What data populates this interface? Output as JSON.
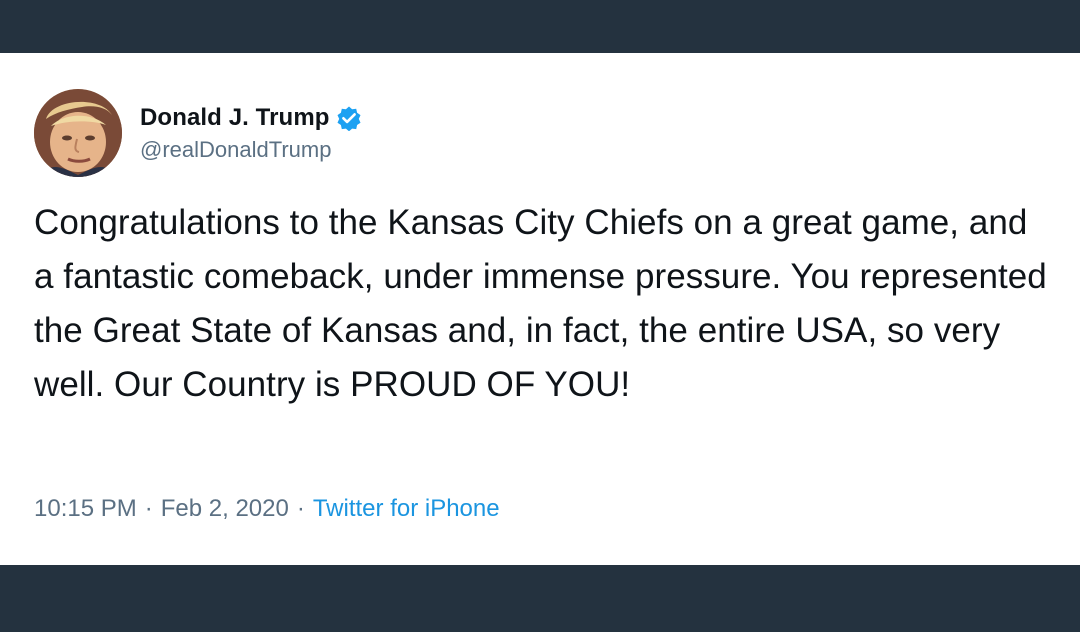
{
  "tweet": {
    "author_name": "Donald J. Trump",
    "author_handle": "@realDonaldTrump",
    "verified_icon": "verified-badge-icon",
    "text": "Congratulations to the Kansas City Chiefs on a great game, and a fantastic comeback, under immense pressure. You represented the Great State of Kansas and, in fact, the entire USA, so very well. Our Country is PROUD OF YOU!",
    "time": "10:15 PM",
    "date": "Feb 2, 2020",
    "source": "Twitter for iPhone",
    "separator": "·"
  },
  "colors": {
    "background": "#24323f",
    "card": "#ffffff",
    "text": "#0f1419",
    "muted": "#5b7083",
    "link": "#1b95e0",
    "verified": "#1da1f2"
  }
}
